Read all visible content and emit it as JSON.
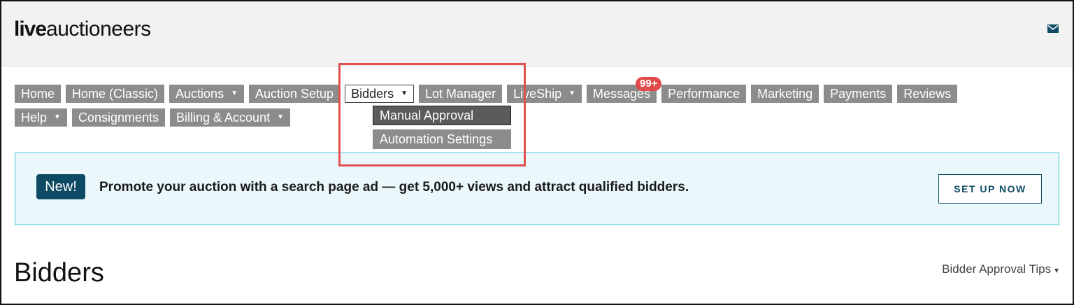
{
  "brand": {
    "logo_bold": "live",
    "logo_light": "auctioneers"
  },
  "header": {
    "mail_icon": "envelope-icon"
  },
  "nav": {
    "row1": [
      {
        "label": "Home",
        "caret": false
      },
      {
        "label": "Home (Classic)",
        "caret": false
      },
      {
        "label": "Auctions",
        "caret": true
      },
      {
        "label": "Auction Setup",
        "caret": false
      },
      {
        "label": "Bidders",
        "caret": true,
        "active": true
      },
      {
        "label": "Lot Manager",
        "caret": false
      },
      {
        "label": "LiveShip",
        "caret": true
      },
      {
        "label": "Messages",
        "caret": false,
        "badge": "99+"
      },
      {
        "label": "Performance",
        "caret": false
      },
      {
        "label": "Marketing",
        "caret": false
      },
      {
        "label": "Payments",
        "caret": false
      },
      {
        "label": "Reviews",
        "caret": false
      }
    ],
    "row2": [
      {
        "label": "Help",
        "caret": true
      },
      {
        "label": "Consignments",
        "caret": false
      },
      {
        "label": "Billing & Account",
        "caret": true
      }
    ],
    "caret_glyph": "▼"
  },
  "bidders_dropdown": {
    "items": [
      {
        "label": "Manual Approval",
        "selected": true
      },
      {
        "label": "Automation Settings",
        "selected": false
      }
    ]
  },
  "promo": {
    "badge": "New!",
    "text": "Promote your auction with a search page ad — get 5,000+ views and attract qualified bidders.",
    "button": "SET UP NOW"
  },
  "page": {
    "title": "Bidders",
    "tips_label": "Bidder Approval Tips"
  },
  "colors": {
    "nav_bg": "#8c8c8c",
    "highlight": "#e05050",
    "promo_bg": "#eaf7fb",
    "promo_border": "#48c4d6",
    "brand_dark": "#0d4a63",
    "badge_red": "#e04a4a"
  }
}
